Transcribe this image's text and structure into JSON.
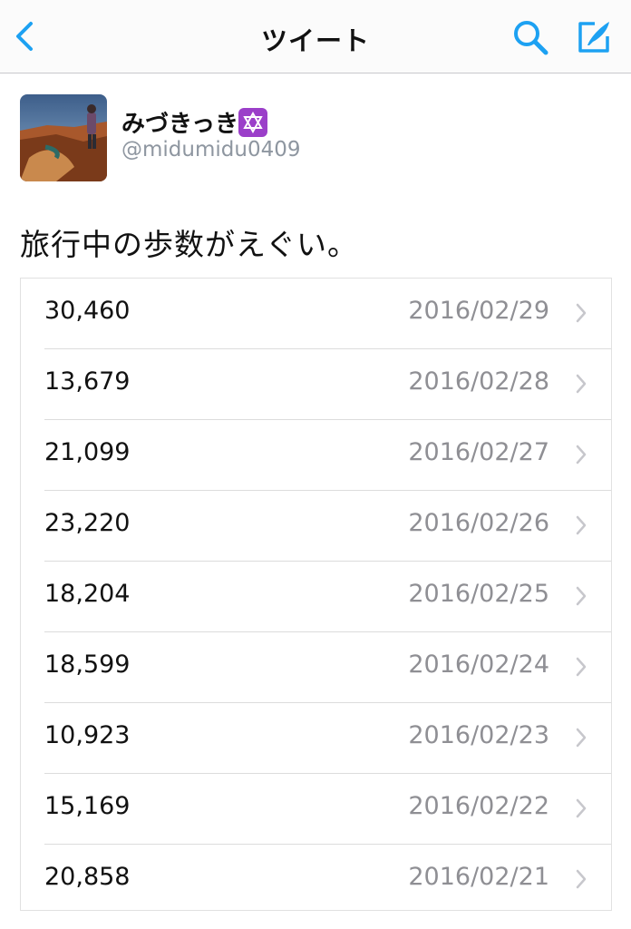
{
  "navbar": {
    "title": "ツイート",
    "back_icon": "chevron-left-icon",
    "search_icon": "search-icon",
    "compose_icon": "compose-tweet-icon",
    "accent_color": "#1da1f2"
  },
  "tweet": {
    "author_name": "みづきっき",
    "author_badge": "star-of-david-emoji",
    "handle": "@midumidu0409",
    "text": "旅行中の歩数がえぐい。"
  },
  "steps_list": {
    "rows": [
      {
        "steps": "30,460",
        "date": "2016/02/29"
      },
      {
        "steps": "13,679",
        "date": "2016/02/28"
      },
      {
        "steps": "21,099",
        "date": "2016/02/27"
      },
      {
        "steps": "23,220",
        "date": "2016/02/26"
      },
      {
        "steps": "18,204",
        "date": "2016/02/25"
      },
      {
        "steps": "18,599",
        "date": "2016/02/24"
      },
      {
        "steps": "10,923",
        "date": "2016/02/23"
      },
      {
        "steps": "15,169",
        "date": "2016/02/22"
      },
      {
        "steps": "20,858",
        "date": "2016/02/21"
      }
    ]
  }
}
